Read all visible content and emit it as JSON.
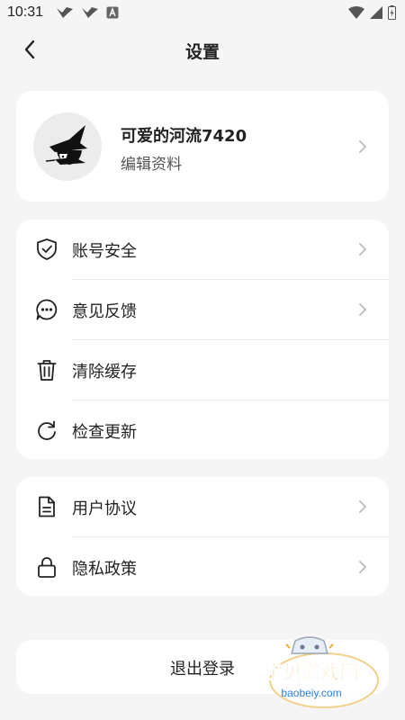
{
  "status_bar": {
    "time": "10:31"
  },
  "header": {
    "title": "设置"
  },
  "profile": {
    "name": "可爱的河流7420",
    "edit_label": "编辑资料"
  },
  "menu_group_1": {
    "items": [
      {
        "label": "账号安全",
        "icon": "shield-check-icon",
        "has_chevron": true
      },
      {
        "label": "意见反馈",
        "icon": "chat-bubble-icon",
        "has_chevron": true
      },
      {
        "label": "清除缓存",
        "icon": "trash-icon",
        "has_chevron": false
      },
      {
        "label": "检查更新",
        "icon": "refresh-icon",
        "has_chevron": false
      }
    ]
  },
  "menu_group_2": {
    "items": [
      {
        "label": "用户协议",
        "icon": "document-icon",
        "has_chevron": true
      },
      {
        "label": "隐私政策",
        "icon": "lock-icon",
        "has_chevron": true
      }
    ]
  },
  "logout": {
    "label": "退出登录"
  },
  "watermark": {
    "brand": "宝贝游戏网",
    "url": "baobeiy.com"
  }
}
